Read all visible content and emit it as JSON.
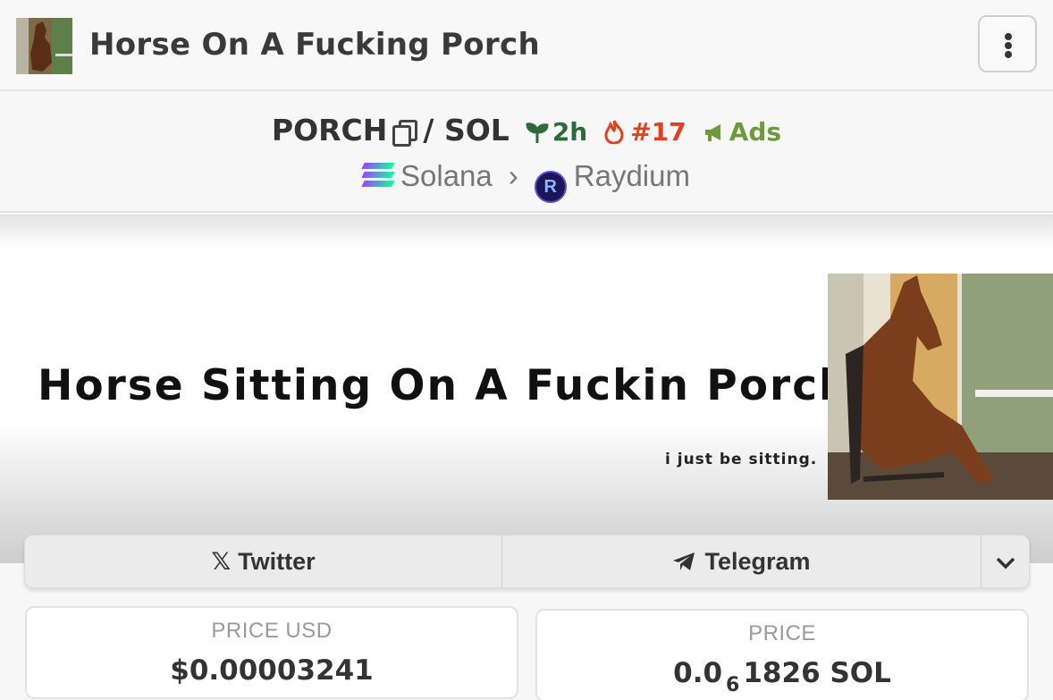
{
  "header": {
    "token_name": "Horse On A Fucking Porch",
    "menu_icon": "more-vertical-icon"
  },
  "pair": {
    "base_symbol": "PORCH",
    "separator": "/",
    "quote_symbol": "SOL",
    "age": "2h",
    "trending_rank": "#17",
    "ads_label": "Ads",
    "colors": {
      "age": "#2e6b3a",
      "trending": "#e0411f",
      "ads": "#6c9a3c"
    }
  },
  "chain": {
    "network": "Solana",
    "dex": "Raydium"
  },
  "banner": {
    "title": "Horse Sitting On A Fuckin Porch",
    "subtitle": "i just be sitting."
  },
  "socials": {
    "twitter": "Twitter",
    "telegram": "Telegram",
    "more_icon": "chevron-down-icon"
  },
  "prices": {
    "usd_label": "PRICE USD",
    "usd_value": "$0.00003241",
    "native_label": "PRICE",
    "native_prefix": "0.0",
    "native_zero_count": "6",
    "native_digits": "1826",
    "native_unit": "SOL"
  }
}
